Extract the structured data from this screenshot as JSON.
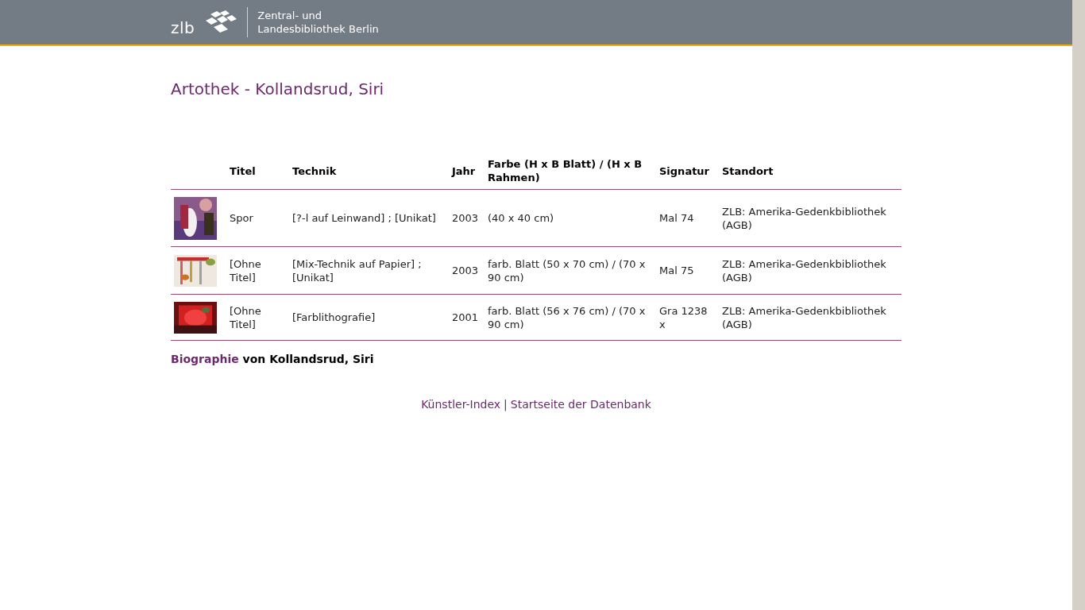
{
  "header": {
    "logo": "zlb",
    "library_name": [
      "Zentral- und",
      "Landesbibliothek Berlin"
    ]
  },
  "page_title": "Artothek - Kollandsrud, Siri",
  "table": {
    "columns": [
      "",
      "Titel",
      "Technik",
      "Jahr",
      "Farbe (H x B Blatt) / (H x B Rahmen)",
      "Signatur",
      "Standort"
    ],
    "rows": [
      {
        "titel": "Spor",
        "technik": "[?-l auf Leinwand] ; [Unikat]",
        "jahr": "2003",
        "farbe": "(40 x 40 cm)",
        "signatur": "Mal 74",
        "standort": "ZLB: Amerika-Gedenkbibliothek (AGB)"
      },
      {
        "titel": "[Ohne Titel]",
        "technik": "[Mix-Technik auf Papier] ; [Unikat]",
        "jahr": "2003",
        "farbe": "farb. Blatt (50 x 70 cm) / (70 x 90 cm)",
        "signatur": "Mal 75",
        "standort": "ZLB: Amerika-Gedenkbibliothek (AGB)"
      },
      {
        "titel": "[Ohne Titel]",
        "technik": "[Farblithografie]",
        "jahr": "2001",
        "farbe": "farb. Blatt (56 x 76 cm) / (70 x 90 cm)",
        "signatur": "Gra 1238 x",
        "standort": "ZLB: Amerika-Gedenkbibliothek (AGB)"
      }
    ]
  },
  "biography": {
    "link": "Biographie",
    "text": " von Kollandsrud, Siri"
  },
  "footer_links": [
    {
      "label": "Künstler-Index"
    },
    {
      "label": "Startseite der Datenbank"
    }
  ],
  "footer_separator": "|"
}
